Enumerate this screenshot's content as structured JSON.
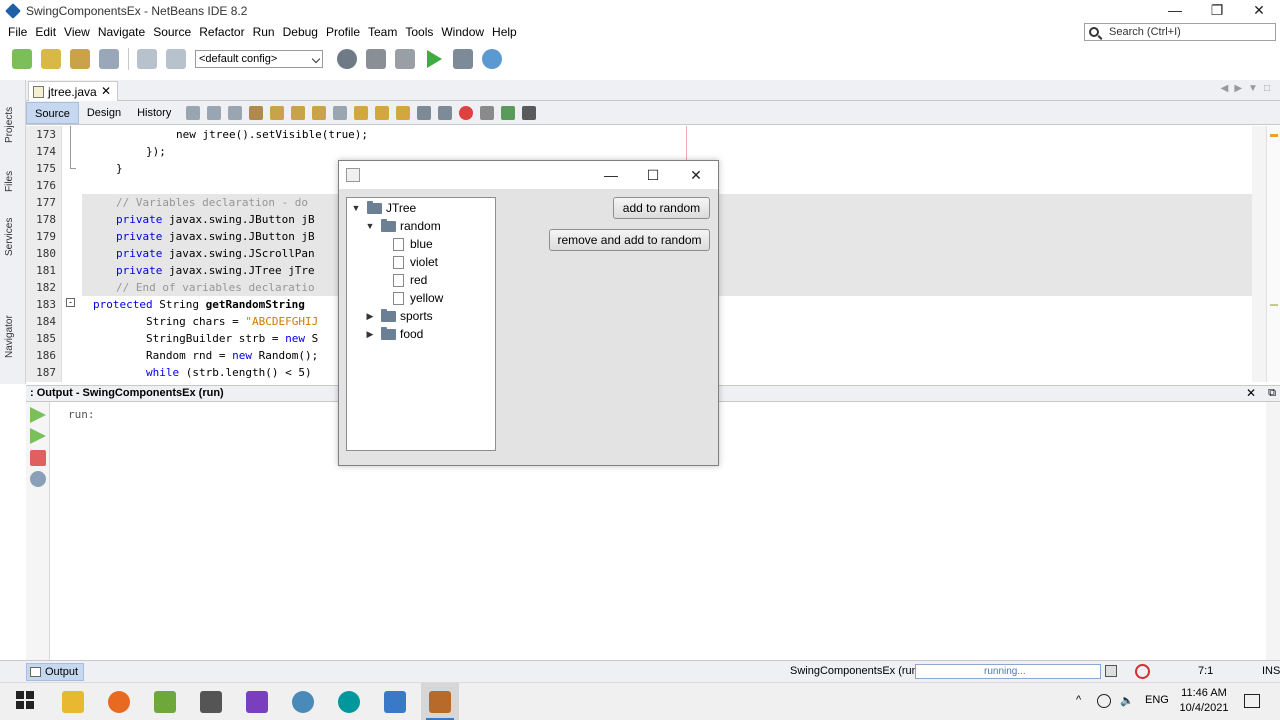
{
  "window": {
    "title": "SwingComponentsEx - NetBeans IDE 8.2",
    "controls": {
      "minimize": "—",
      "restore": "❐",
      "close": "✕"
    }
  },
  "menu": [
    "File",
    "Edit",
    "View",
    "Navigate",
    "Source",
    "Refactor",
    "Run",
    "Debug",
    "Profile",
    "Team",
    "Tools",
    "Window",
    "Help"
  ],
  "search": {
    "placeholder": "Search (Ctrl+I)"
  },
  "toolbar": {
    "config": "<default config>"
  },
  "side_tabs": [
    "Projects",
    "Files",
    "Services",
    "Navigator"
  ],
  "editor": {
    "tab_label": "jtree.java",
    "tab_close": "✕",
    "subtabs": [
      "Source",
      "Design",
      "History"
    ],
    "line_numbers": [
      "173",
      "174",
      "175",
      "176",
      "177",
      "178",
      "179",
      "180",
      "181",
      "182",
      "183",
      "184",
      "185",
      "186",
      "187"
    ],
    "lines": {
      "l173": "new jtree().setVisible(true);",
      "l174": "});",
      "l175": "}",
      "l177": "// Variables declaration - do",
      "l178_kw": "private",
      "l178": " javax.swing.JButton jB",
      "l179_kw": "private",
      "l179": " javax.swing.JButton jB",
      "l180_kw": "private",
      "l180": " javax.swing.JScrollPan",
      "l181_kw": "private",
      "l181": " javax.swing.JTree jTre",
      "l182": "// End of variables declaratio",
      "l183_kw": "protected",
      "l183_type": " String ",
      "l183_fn": "getRandomString",
      "l184_a": "String chars = ",
      "l184_str": "\"ABCDEFGHIJ",
      "l185_a": "StringBuilder strb = ",
      "l185_kw": "new",
      "l185_b": " S",
      "l186_a": "Random rnd = ",
      "l186_kw": "new",
      "l186_b": " Random();",
      "l187_kw": "while",
      "l187_b": " (strb.length() < 5)"
    }
  },
  "output": {
    "header": ": Output - SwingComponentsEx (run)",
    "close": "✕",
    "text": "run:"
  },
  "status": {
    "output_tab": "Output",
    "process": "SwingComponentsEx (run)",
    "progress_text": "running...",
    "position": "7:1",
    "mode": "INS"
  },
  "taskbar": {
    "language": "ENG",
    "time": "11:46 AM",
    "date": "10/4/2021",
    "tray_chevron": "^"
  },
  "dialog": {
    "controls": {
      "minimize": "—",
      "maximize": "☐",
      "close": "✕"
    },
    "tree": {
      "root": "JTree",
      "random": "random",
      "blue": "blue",
      "violet": "violet",
      "red": "red",
      "yellow": "yellow",
      "sports": "sports",
      "food": "food"
    },
    "buttons": {
      "add": "add to random",
      "remove_add": "remove and add to random"
    }
  },
  "colors": {
    "accent": "#c5d8f0",
    "keyword": "#0000e6",
    "comment": "#969696",
    "string": "#ce7b00"
  }
}
